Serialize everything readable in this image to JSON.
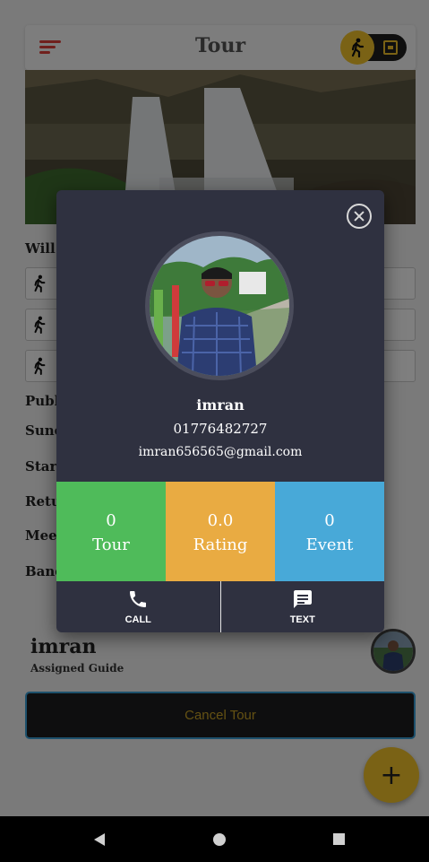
{
  "app": {
    "title": "Tour",
    "bg_labels": [
      "Will",
      "Publi",
      "Sund",
      "Start",
      "Retu",
      "Meet",
      "Band"
    ]
  },
  "guide": {
    "name": "imran",
    "role": "Assigned Guide"
  },
  "cancel_button": "Cancel Tour",
  "fab_label": "+",
  "dialog": {
    "name": "imran",
    "phone": "01776482727",
    "email": "imran656565@gmail.com",
    "stats": [
      {
        "value": "0",
        "label": "Tour"
      },
      {
        "value": "0.0",
        "label": "Rating"
      },
      {
        "value": "0",
        "label": "Event"
      }
    ],
    "actions": {
      "call": "CALL",
      "text": "TEXT"
    }
  },
  "colors": {
    "accent_yellow": "#f5c52a",
    "stat_tour": "#4fbb5a",
    "stat_rating": "#e9ab42",
    "stat_event": "#48a9d8",
    "dialog_bg": "#2f3140",
    "menu_red": "#e0413a"
  },
  "icons": {
    "menu": "hamburger-menu-icon",
    "walk": "walking-person-icon",
    "calendar": "calendar-icon",
    "close": "close-circle-icon",
    "call": "phone-icon",
    "text": "message-icon"
  }
}
